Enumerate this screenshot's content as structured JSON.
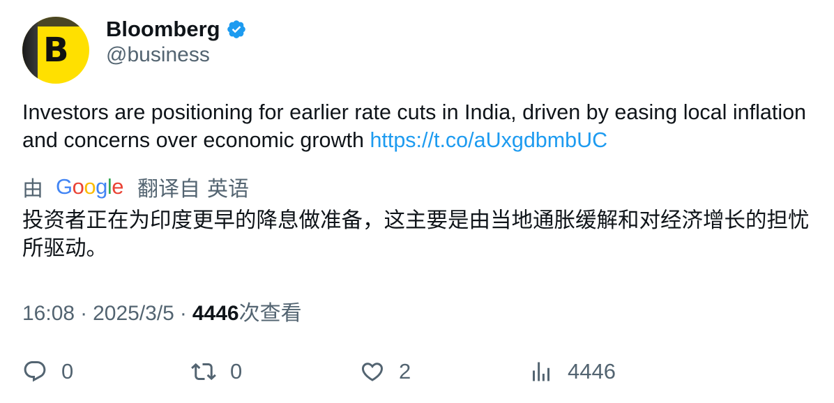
{
  "account": {
    "display_name": "Bloomberg",
    "handle": "@business",
    "avatar_letter": "B",
    "avatar_color": "#ffe000",
    "verified_icon": "verified-badge-icon",
    "verified_color": "#1d9bf0"
  },
  "tweet": {
    "text": "Investors are positioning for earlier rate cuts in India, driven by easing local inflation and concerns over economic growth ",
    "link": "https://t.co/aUxgdbmbUC",
    "link_color": "#1d9bf0"
  },
  "translation": {
    "by_label": "由",
    "provider": "Google",
    "from_label": "翻译自",
    "language": "英语",
    "text": "投资者正在为印度更早的降息做准备，这主要是由当地通胀缓解和对经济增长的担忧所驱动。"
  },
  "meta": {
    "time": "16:08",
    "separator": "·",
    "date": "2025/3/5",
    "views_count": "4446",
    "views_label": "次查看"
  },
  "actions": {
    "reply": {
      "icon": "reply-icon",
      "count": "0"
    },
    "retweet": {
      "icon": "retweet-icon",
      "count": "0"
    },
    "like": {
      "icon": "heart-icon",
      "count": "2"
    },
    "views": {
      "icon": "analytics-icon",
      "count": "4446"
    }
  }
}
